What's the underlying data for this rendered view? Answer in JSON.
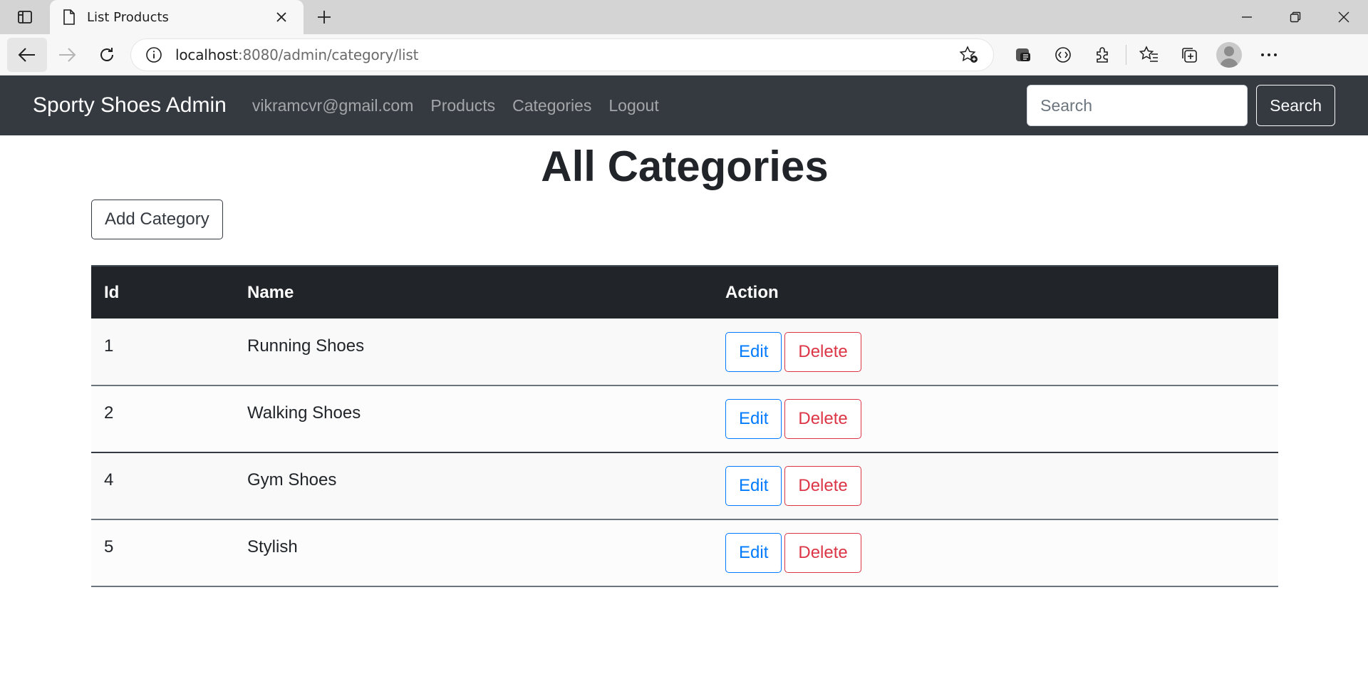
{
  "browser": {
    "tab_title": "List Products",
    "url_host": "localhost",
    "url_rest": ":8080/admin/category/list",
    "icons": [
      "sidebar-icon",
      "page-icon",
      "close-icon",
      "plus-icon",
      "minimize-icon",
      "restore-icon",
      "window-close-icon",
      "back-icon",
      "forward-icon",
      "refresh-icon",
      "info-icon",
      "add-favorite-icon",
      "collection-icon",
      "devtools-icon",
      "extensions-icon",
      "favorites-icon",
      "collections-icon",
      "profile-icon",
      "more-icon"
    ]
  },
  "navbar": {
    "brand": "Sporty Shoes Admin",
    "links": [
      "vikramcvr@gmail.com",
      "Products",
      "Categories",
      "Logout"
    ],
    "search_placeholder": "Search",
    "search_button": "Search"
  },
  "main": {
    "title": "All Categories",
    "add_button": "Add Category",
    "table": {
      "headers": [
        "Id",
        "Name",
        "Action"
      ],
      "edit_label": "Edit",
      "delete_label": "Delete",
      "rows": [
        {
          "id": "1",
          "name": "Running Shoes"
        },
        {
          "id": "2",
          "name": "Walking Shoes"
        },
        {
          "id": "4",
          "name": "Gym Shoes"
        },
        {
          "id": "5",
          "name": "Stylish"
        }
      ]
    }
  },
  "colors": {
    "navbar_bg": "#343a40",
    "table_header_bg": "#212529",
    "edit_accent": "#007bff",
    "delete_accent": "#dc3545"
  }
}
